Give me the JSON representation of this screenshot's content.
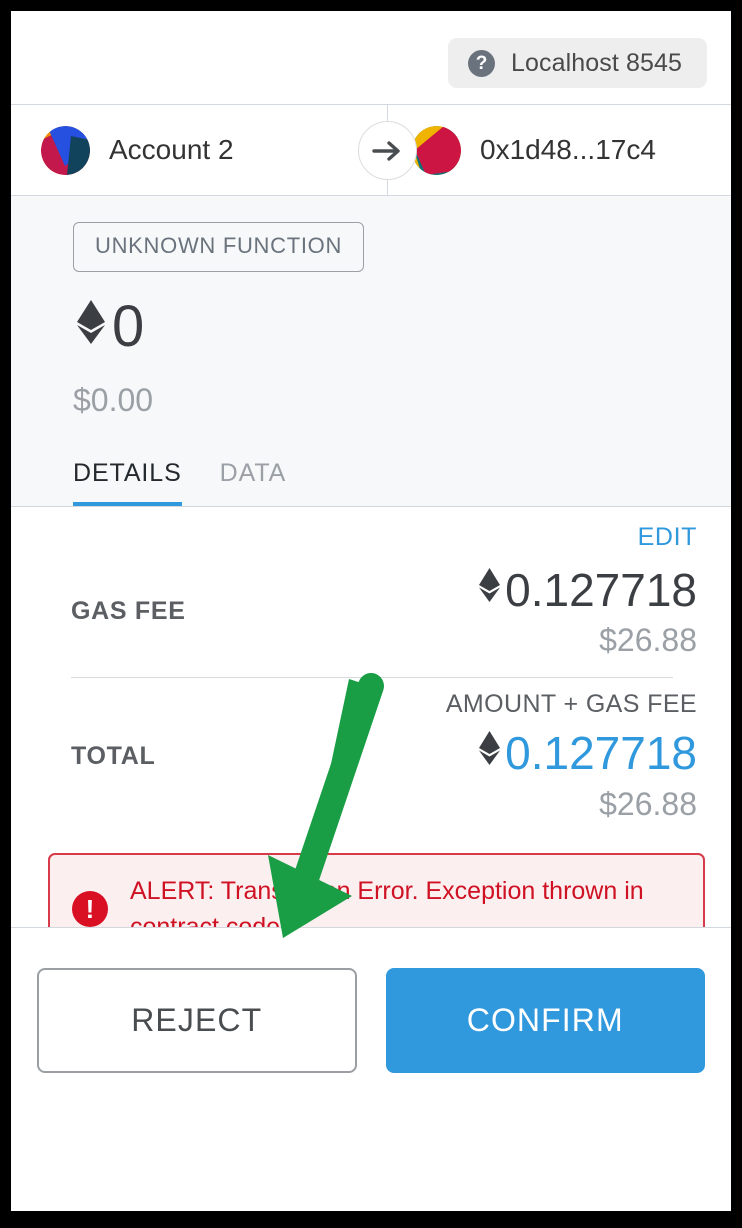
{
  "header": {
    "network_icon": "question-mark-icon",
    "network_name": "Localhost 8545"
  },
  "parties": {
    "sender": {
      "icon": "account-identicon",
      "label": "Account 2"
    },
    "transfer_icon": "arrow-right-icon",
    "recipient": {
      "icon": "recipient-identicon",
      "label": "0x1d48...17c4"
    }
  },
  "summary": {
    "function_pill": "UNKNOWN FUNCTION",
    "currency_icon": "ethereum-icon",
    "amount": "0",
    "fiat_amount": "$0.00",
    "tabs": [
      {
        "label": "DETAILS",
        "active": true
      },
      {
        "label": "DATA",
        "active": false
      }
    ]
  },
  "details": {
    "edit_label": "EDIT",
    "gas_fee": {
      "label": "GAS FEE",
      "currency_icon": "ethereum-icon",
      "amount": "0.127718",
      "fiat": "$26.88"
    },
    "total": {
      "label": "TOTAL",
      "sublabel": "AMOUNT + GAS FEE",
      "currency_icon": "ethereum-icon",
      "amount": "0.127718",
      "fiat": "$26.88"
    }
  },
  "alert": {
    "icon": "error-exclamation-icon",
    "message": "ALERT: Transaction Error. Exception thrown in contract code."
  },
  "footer": {
    "reject_label": "REJECT",
    "confirm_label": "CONFIRM"
  },
  "annotation": {
    "arrow_icon": "green-pointer-arrow",
    "color": "#1a9e45"
  },
  "colors": {
    "accent_blue": "#3098dd",
    "alert_red": "#cf1124",
    "alert_bg": "#fcefef",
    "muted_gray": "#9aa0a6",
    "summary_bg": "#f7f8f9"
  }
}
